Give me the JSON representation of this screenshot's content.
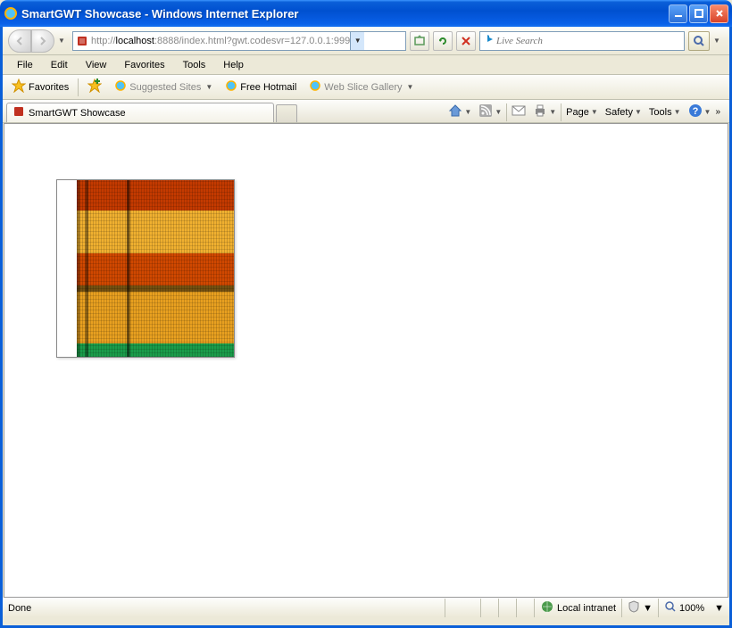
{
  "window": {
    "title": "SmartGWT Showcase - Windows Internet Explorer"
  },
  "address": {
    "prefix": "http://",
    "host": "localhost",
    "rest": ":8888/index.html?gwt.codesvr=127.0.0.1:999"
  },
  "search": {
    "placeholder": "Live Search"
  },
  "menu": {
    "file": "File",
    "edit": "Edit",
    "view": "View",
    "favorites": "Favorites",
    "tools": "Tools",
    "help": "Help"
  },
  "favbar": {
    "favorites": "Favorites",
    "suggested": "Suggested Sites",
    "hotmail": "Free Hotmail",
    "webslice": "Web Slice Gallery"
  },
  "tab": {
    "title": "SmartGWT Showcase"
  },
  "commands": {
    "page": "Page",
    "safety": "Safety",
    "tools": "Tools",
    "chevrons": "»"
  },
  "status": {
    "done": "Done",
    "zone": "Local intranet",
    "zoom": "100%"
  }
}
